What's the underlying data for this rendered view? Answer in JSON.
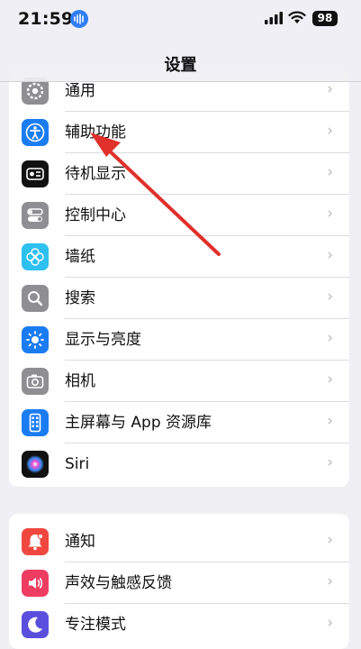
{
  "status_bar": {
    "time": "21:59",
    "battery": "98"
  },
  "nav": {
    "title": "设置"
  },
  "group1": [
    {
      "label": "通用",
      "icon": "gear-icon",
      "color": "#8e8e93"
    },
    {
      "label": "辅助功能",
      "icon": "accessibility-icon",
      "color": "#1a7cf2"
    },
    {
      "label": "待机显示",
      "icon": "standby-icon",
      "color": "#111111"
    },
    {
      "label": "控制中心",
      "icon": "toggles-icon",
      "color": "#8e8e93"
    },
    {
      "label": "墙纸",
      "icon": "flower-icon",
      "color": "#2dc0f0"
    },
    {
      "label": "搜索",
      "icon": "search-icon",
      "color": "#8e8e93"
    },
    {
      "label": "显示与亮度",
      "icon": "sun-icon",
      "color": "#1a7cf2"
    },
    {
      "label": "相机",
      "icon": "camera-icon",
      "color": "#8e8e93"
    },
    {
      "label": "主屏幕与 App 资源库",
      "icon": "home-screen-icon",
      "color": "#1a7cf2"
    },
    {
      "label": "Siri",
      "icon": "siri-icon",
      "color": "#111111"
    }
  ],
  "group2": [
    {
      "label": "通知",
      "icon": "bell-icon",
      "color": "#f0483e"
    },
    {
      "label": "声效与触感反馈",
      "icon": "speaker-icon",
      "color": "#ef3d62"
    },
    {
      "label": "专注模式",
      "icon": "moon-icon",
      "color": "#5a4fdc"
    }
  ],
  "annotation": {
    "type": "red-arrow",
    "points_to": "辅助功能"
  }
}
